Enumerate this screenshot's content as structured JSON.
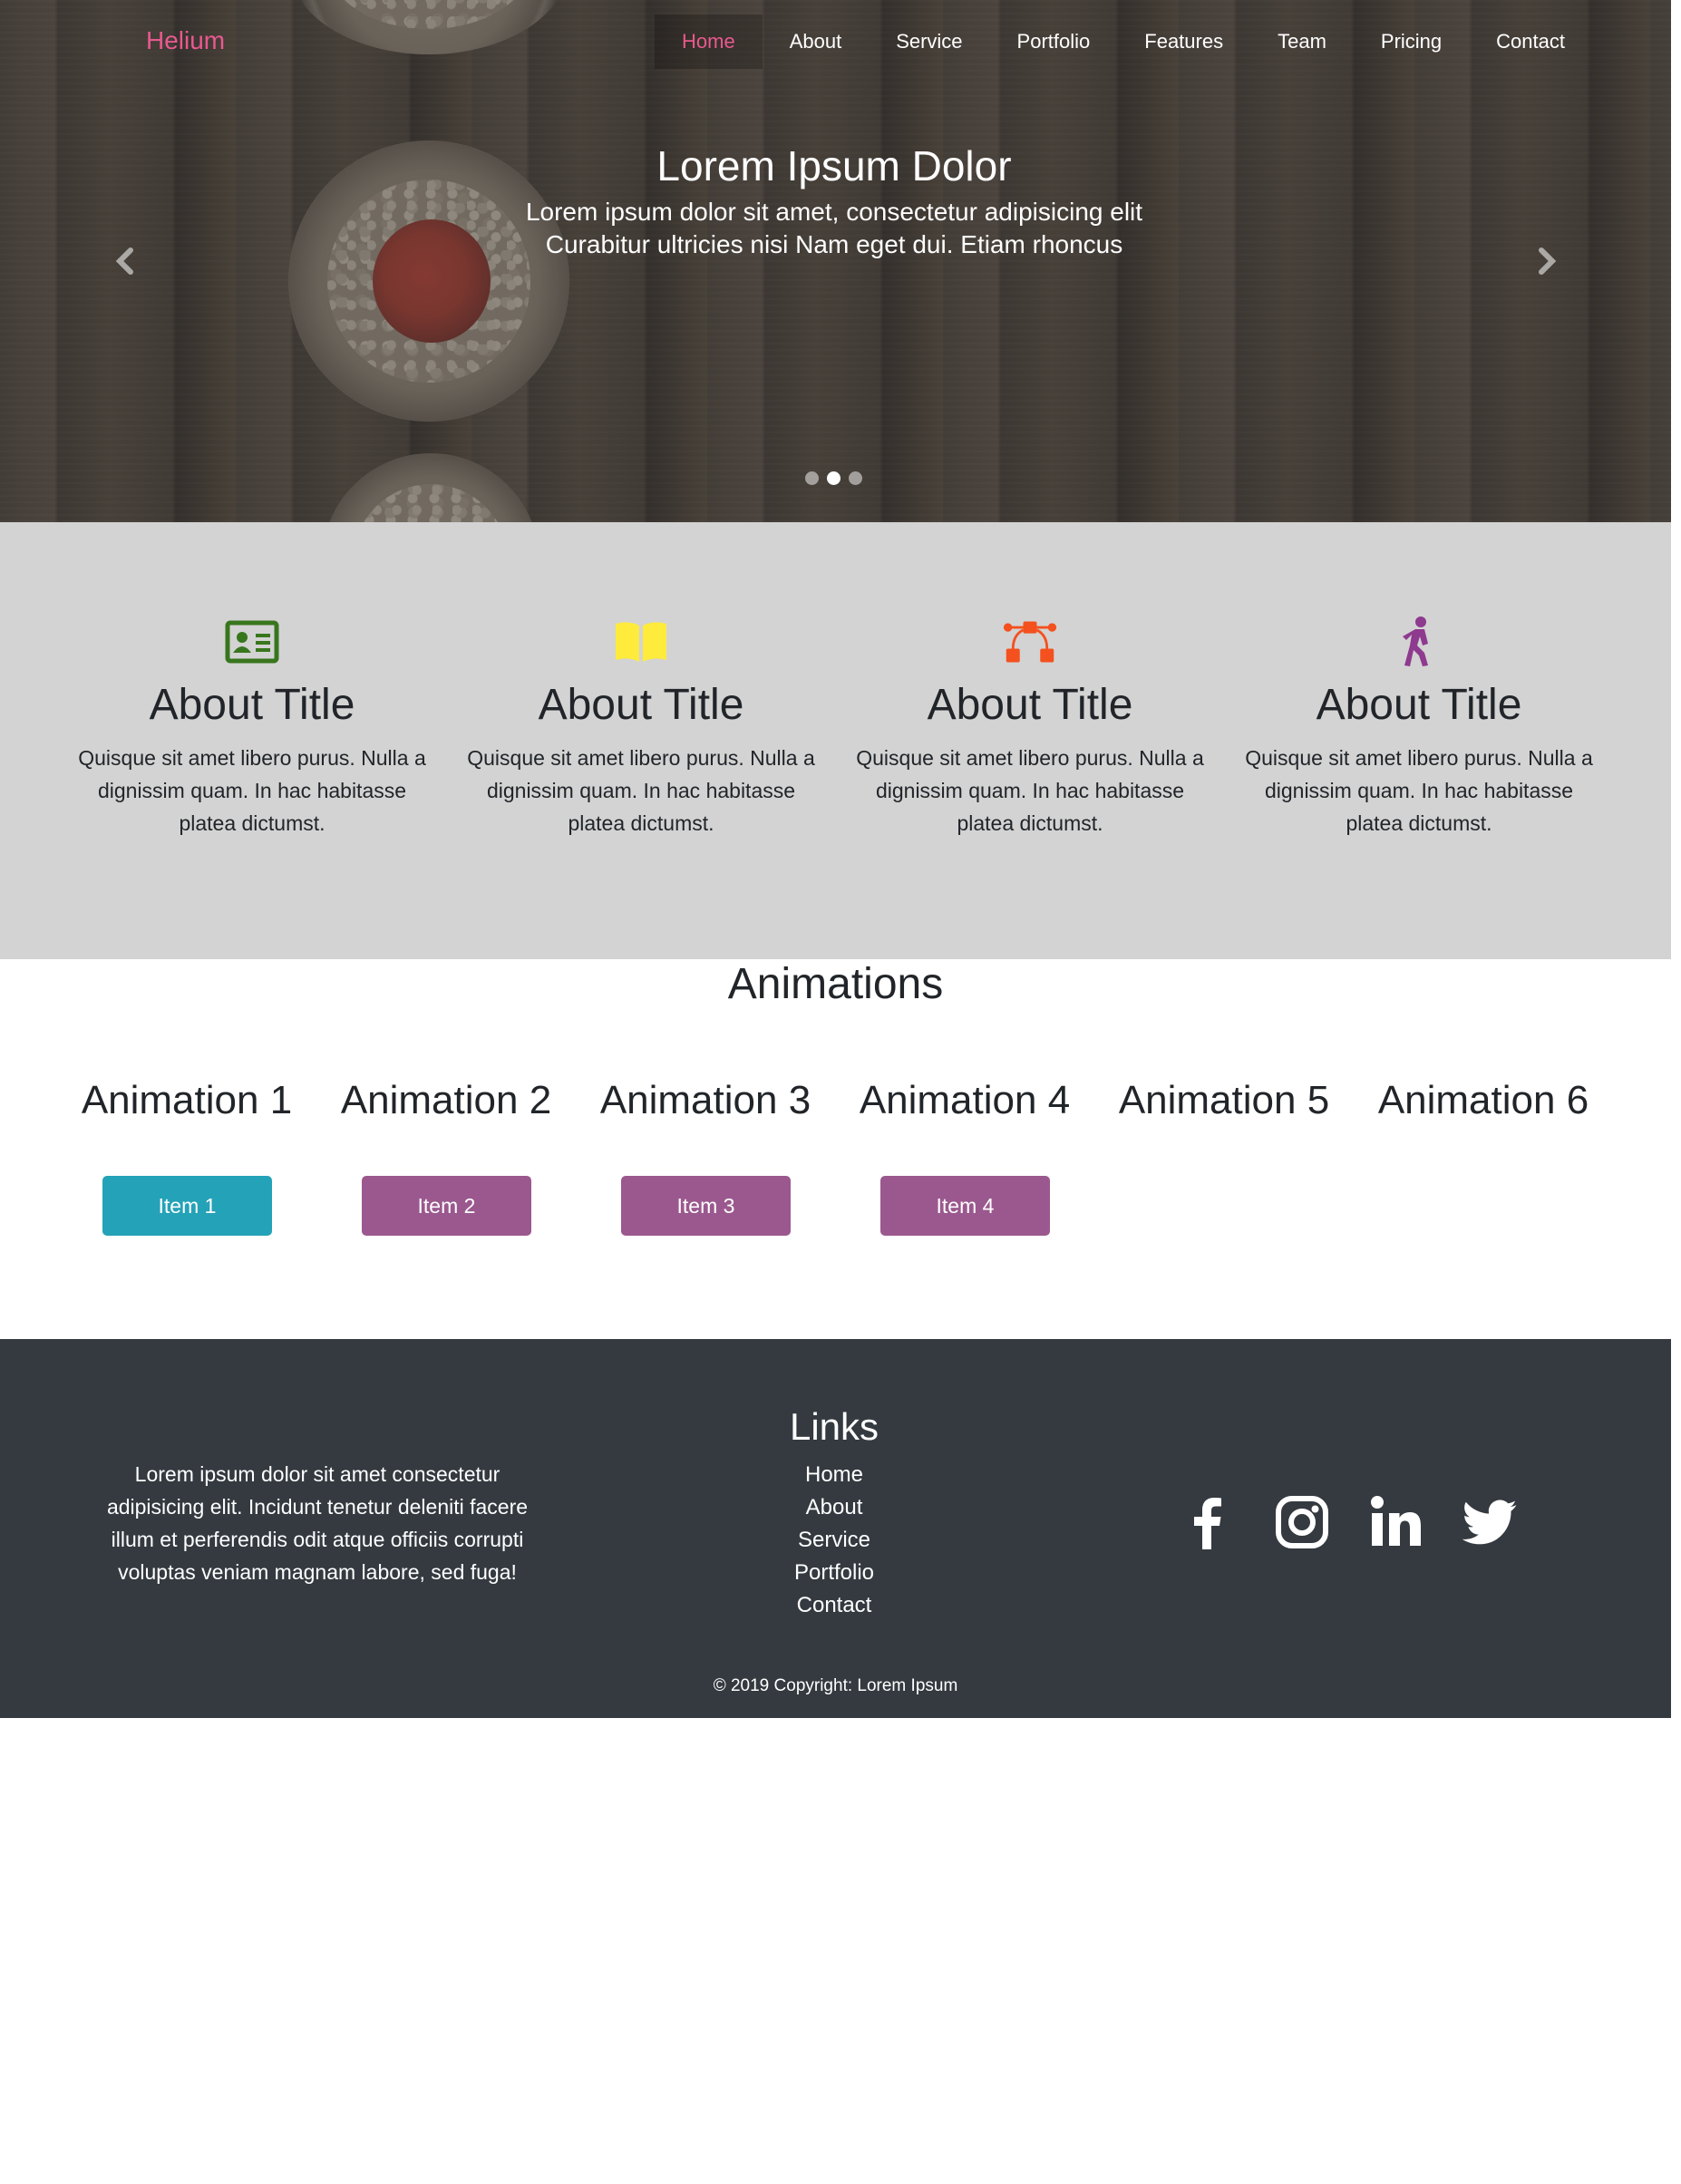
{
  "brand": "Helium",
  "nav": {
    "items": [
      {
        "label": "Home",
        "active": true
      },
      {
        "label": "About"
      },
      {
        "label": "Service"
      },
      {
        "label": "Portfolio"
      },
      {
        "label": "Features"
      },
      {
        "label": "Team"
      },
      {
        "label": "Pricing"
      },
      {
        "label": "Contact"
      }
    ]
  },
  "hero": {
    "title": "Lorem Ipsum Dolor",
    "text": "Lorem ipsum dolor sit amet, consectetur adipisicing elit Curabitur ultricies nisi Nam eget dui. Etiam rhoncus",
    "prev_icon": "chevron-left-icon",
    "next_icon": "chevron-right-icon",
    "slide_count": 3,
    "active_slide": 2
  },
  "about": {
    "items": [
      {
        "icon": "id-card-icon",
        "icon_color": "#38761d",
        "title": "About Title",
        "text": "Quisque sit amet libero purus. Nulla a dignissim quam. In hac habitasse platea dictumst."
      },
      {
        "icon": "book-open-icon",
        "icon_color": "#ffeb3b",
        "title": "About Title",
        "text": "Quisque sit amet libero purus. Nulla a dignissim quam. In hac habitasse platea dictumst."
      },
      {
        "icon": "bezier-curve-icon",
        "icon_color": "#f4511e",
        "title": "About Title",
        "text": "Quisque sit amet libero purus. Nulla a dignissim quam. In hac habitasse platea dictumst."
      },
      {
        "icon": "walking-icon",
        "icon_color": "#8e3a8e",
        "title": "About Title",
        "text": "Quisque sit amet libero purus. Nulla a dignissim quam. In hac habitasse platea dictumst."
      }
    ]
  },
  "animations": {
    "title": "Animations",
    "labels": [
      "Animation 1",
      "Animation 2",
      "Animation 3",
      "Animation 4",
      "Animation 5",
      "Animation 6"
    ],
    "buttons": [
      {
        "label": "Item 1",
        "color": "#24a2b8"
      },
      {
        "label": "Item 2",
        "color": "#9b588e"
      },
      {
        "label": "Item 3",
        "color": "#9b588e"
      },
      {
        "label": "Item 4",
        "color": "#9b588e"
      }
    ]
  },
  "footer": {
    "about_text": "Lorem ipsum dolor sit amet consectetur adipisicing elit. Incidunt tenetur deleniti facere illum et perferendis odit atque officiis corrupti voluptas veniam magnam labore, sed fuga!",
    "links_title": "Links",
    "links": [
      "Home",
      "About",
      "Service",
      "Portfolio",
      "Contact"
    ],
    "social": [
      "facebook-icon",
      "instagram-icon",
      "linkedin-icon",
      "twitter-icon"
    ],
    "copyright": "© 2019 Copyright: Lorem Ipsum"
  },
  "colors": {
    "accent": "#e8598f",
    "about_bg": "#d3d3d3",
    "footer_bg": "#343a40"
  }
}
